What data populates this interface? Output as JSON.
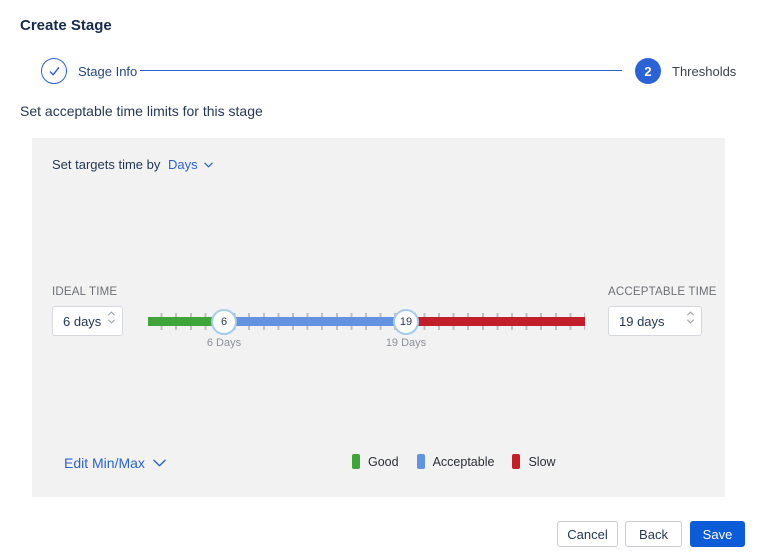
{
  "page": {
    "title": "Create Stage"
  },
  "stepper": {
    "step1": {
      "label": "Stage Info",
      "state": "complete"
    },
    "step2": {
      "number": "2",
      "label": "Thresholds",
      "state": "active"
    }
  },
  "subtitle": "Set acceptable time limits for this stage",
  "panel": {
    "target_time": {
      "label": "Set targets time by",
      "value": "Days"
    },
    "ideal": {
      "label": "IDEAL TIME",
      "value": "6 days"
    },
    "acceptable": {
      "label": "ACCEPTABLE TIME",
      "value": "19 days"
    },
    "slider": {
      "unit": "days",
      "min": {
        "value": "6",
        "label": "6 Days"
      },
      "max": {
        "value": "19",
        "label": "19 Days"
      },
      "segments": [
        {
          "name": "Good",
          "color": "#3fa43a"
        },
        {
          "name": "Acceptable",
          "color": "#6292e0"
        },
        {
          "name": "Slow",
          "color": "#c1202b"
        }
      ]
    },
    "edit_minmax": "Edit Min/Max",
    "legend": [
      {
        "label": "Good",
        "color": "#3fa43a"
      },
      {
        "label": "Acceptable",
        "color": "#6292e0"
      },
      {
        "label": "Slow",
        "color": "#c1202b"
      }
    ]
  },
  "footer": {
    "cancel": "Cancel",
    "back": "Back",
    "save": "Save"
  },
  "colors": {
    "accent_blue": "#2c63d4",
    "save_blue": "#0b5cd6",
    "panel_gray": "#f2f2f2",
    "text_dark": "#253858",
    "label_gray": "#6c6f75",
    "tick_gray": "#bcbfc3",
    "handle_border": "#a5cbee"
  },
  "icons": {
    "check-icon": "✓",
    "chevron-down-icon": "∨",
    "stepper-up-icon": "⌃",
    "stepper-down-icon": "⌄"
  }
}
